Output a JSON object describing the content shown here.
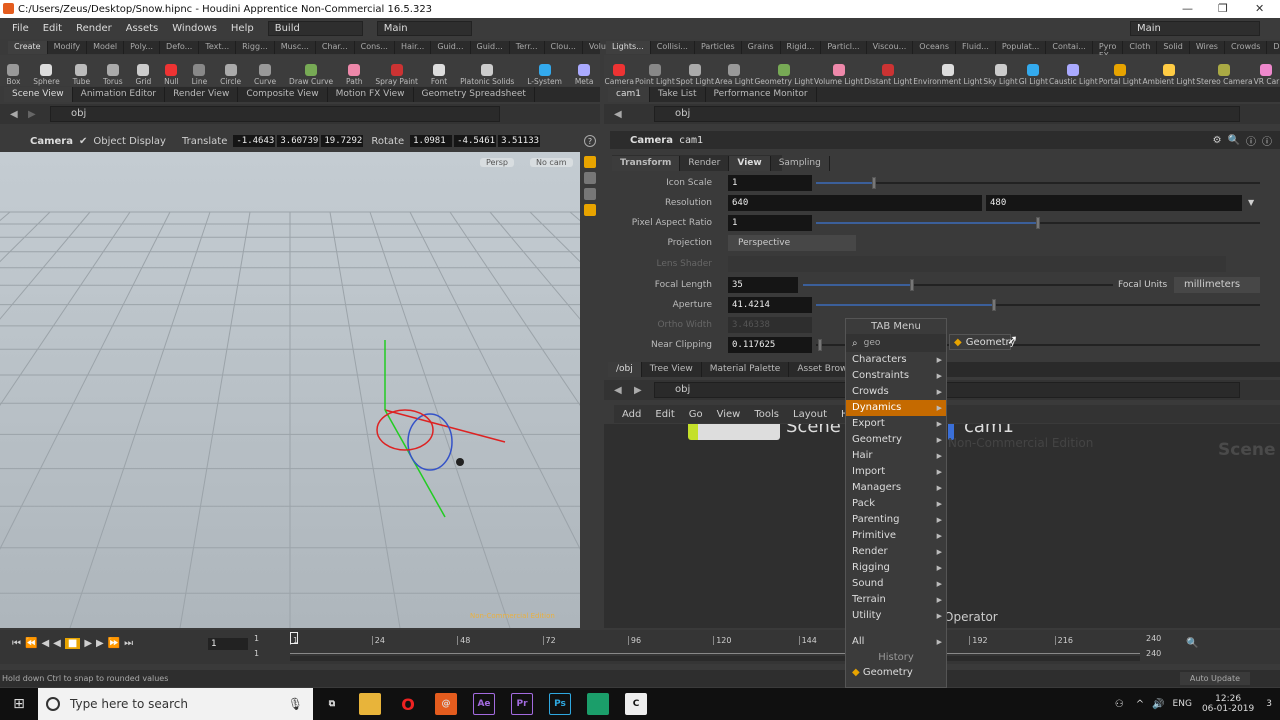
{
  "window": {
    "title": "C:/Users/Zeus/Desktop/Snow.hipnc - Houdini Apprentice Non-Commercial 16.5.323"
  },
  "menubar": {
    "items": [
      "File",
      "Edit",
      "Render",
      "Assets",
      "Windows",
      "Help"
    ],
    "desktop": "Build",
    "desktop2": "Main",
    "right": "Main"
  },
  "shelf_left": {
    "tabs": [
      "Create",
      "Modify",
      "Model",
      "Poly...",
      "Defo...",
      "Text...",
      "Rigg...",
      "Musc...",
      "Char...",
      "Cons...",
      "Hair...",
      "Guid...",
      "Guid...",
      "Terr...",
      "Clou...",
      "Volu..."
    ],
    "tools": [
      "Box",
      "Sphere",
      "Tube",
      "Torus",
      "Grid",
      "Null",
      "Line",
      "Circle",
      "Curve",
      "Draw Curve",
      "Path",
      "Spray Paint",
      "Font",
      "Platonic Solids",
      "L-System",
      "Meta"
    ]
  },
  "shelf_right": {
    "tabs": [
      "Lights...",
      "Collisi...",
      "Particles",
      "Grains",
      "Rigid...",
      "Particl...",
      "Viscou...",
      "Oceans",
      "Fluid...",
      "Populat...",
      "Contai...",
      "Pyro FX",
      "Cloth",
      "Solid",
      "Wires",
      "Crowds",
      "Drive..."
    ],
    "tools": [
      "Camera",
      "Point Light",
      "Spot Light",
      "Area Light",
      "Geometry Light",
      "Volume Light",
      "Distant Light",
      "Environment Light",
      "Sky Light",
      "GI Light",
      "Caustic Light",
      "Portal Light",
      "Ambient Light",
      "Stereo Camera",
      "VR Car"
    ]
  },
  "left_pane": {
    "tabs": [
      "Scene View",
      "Animation Editor",
      "Render View",
      "Composite View",
      "Motion FX View",
      "Geometry Spreadsheet"
    ],
    "path": "obj",
    "toolbar": {
      "camera": "Camera",
      "object_display": "Object Display",
      "translate_label": "Translate",
      "translate": [
        "-1.4643",
        "3.60739",
        "19.7292"
      ],
      "rotate_label": "Rotate",
      "rotate": [
        "1.0981",
        "-4.5461",
        "3.51133"
      ]
    },
    "viewport": {
      "persp": "Persp",
      "cam": "No cam",
      "watermark": "Non-Commercial Edition"
    }
  },
  "param_pane": {
    "tabs": [
      "cam1",
      "Take List",
      "Performance Monitor"
    ],
    "path": "obj",
    "node_type": "Camera",
    "node_name": "cam1",
    "param_tabs": [
      "Transform",
      "Render",
      "View",
      "Sampling"
    ],
    "params": {
      "icon_scale": {
        "label": "Icon Scale",
        "value": "1",
        "fraction": 0.13
      },
      "resolution": {
        "label": "Resolution",
        "w": "640",
        "h": "480"
      },
      "pixel_aspect": {
        "label": "Pixel Aspect Ratio",
        "value": "1",
        "fraction": 0.5
      },
      "projection": {
        "label": "Projection",
        "value": "Perspective"
      },
      "lens_shader": {
        "label": "Lens Shader"
      },
      "focal_length": {
        "label": "Focal Length",
        "value": "35",
        "fraction": 0.35,
        "units_label": "Focal Units",
        "units": "millimeters"
      },
      "aperture": {
        "label": "Aperture",
        "value": "41.4214",
        "fraction": 0.4
      },
      "ortho_width": {
        "label": "Ortho Width",
        "value": "3.46338"
      },
      "near_clipping": {
        "label": "Near Clipping",
        "value": "0.117625"
      }
    }
  },
  "network_pane": {
    "tabs": [
      "/obj",
      "Tree View",
      "Material Palette",
      "Asset Browser"
    ],
    "path": "obj",
    "menu": [
      "Add",
      "Edit",
      "Go",
      "View",
      "Tools",
      "Layout",
      "Help"
    ],
    "node1": "Scene",
    "node2": "cam1",
    "edition": "Non-Commercial Edition",
    "context": "Scene",
    "hint": "Operator"
  },
  "tab_menu": {
    "title": "TAB Menu",
    "search": "geo",
    "result": "Geometry",
    "items": [
      "Characters",
      "Constraints",
      "Crowds",
      "Dynamics",
      "Export",
      "Geometry",
      "Hair",
      "Import",
      "Managers",
      "Pack",
      "Parenting",
      "Primitive",
      "Render",
      "Rigging",
      "Sound",
      "Terrain",
      "Utility"
    ],
    "highlighted": "Dynamics",
    "all": "All",
    "history_label": "History",
    "history": [
      "Geometry"
    ]
  },
  "timeline": {
    "frame": "1",
    "start": "1",
    "start2": "1",
    "ticks": [
      "1",
      "24",
      "48",
      "72",
      "96",
      "120",
      "144",
      "192",
      "216"
    ],
    "end": "240",
    "end2": "240",
    "current": 1,
    "range": [
      1,
      240
    ]
  },
  "status": {
    "message": "Hold down Ctrl to snap to rounded values",
    "auto_update": "Auto Update"
  },
  "taskbar": {
    "search_placeholder": "Type here to search",
    "lang": "ENG",
    "time": "12:26",
    "date": "06-01-2019",
    "notifications": "3"
  },
  "colors": {
    "accent": "#c56a00",
    "highlight": "#e8a400",
    "panel": "#3a3a3a"
  }
}
